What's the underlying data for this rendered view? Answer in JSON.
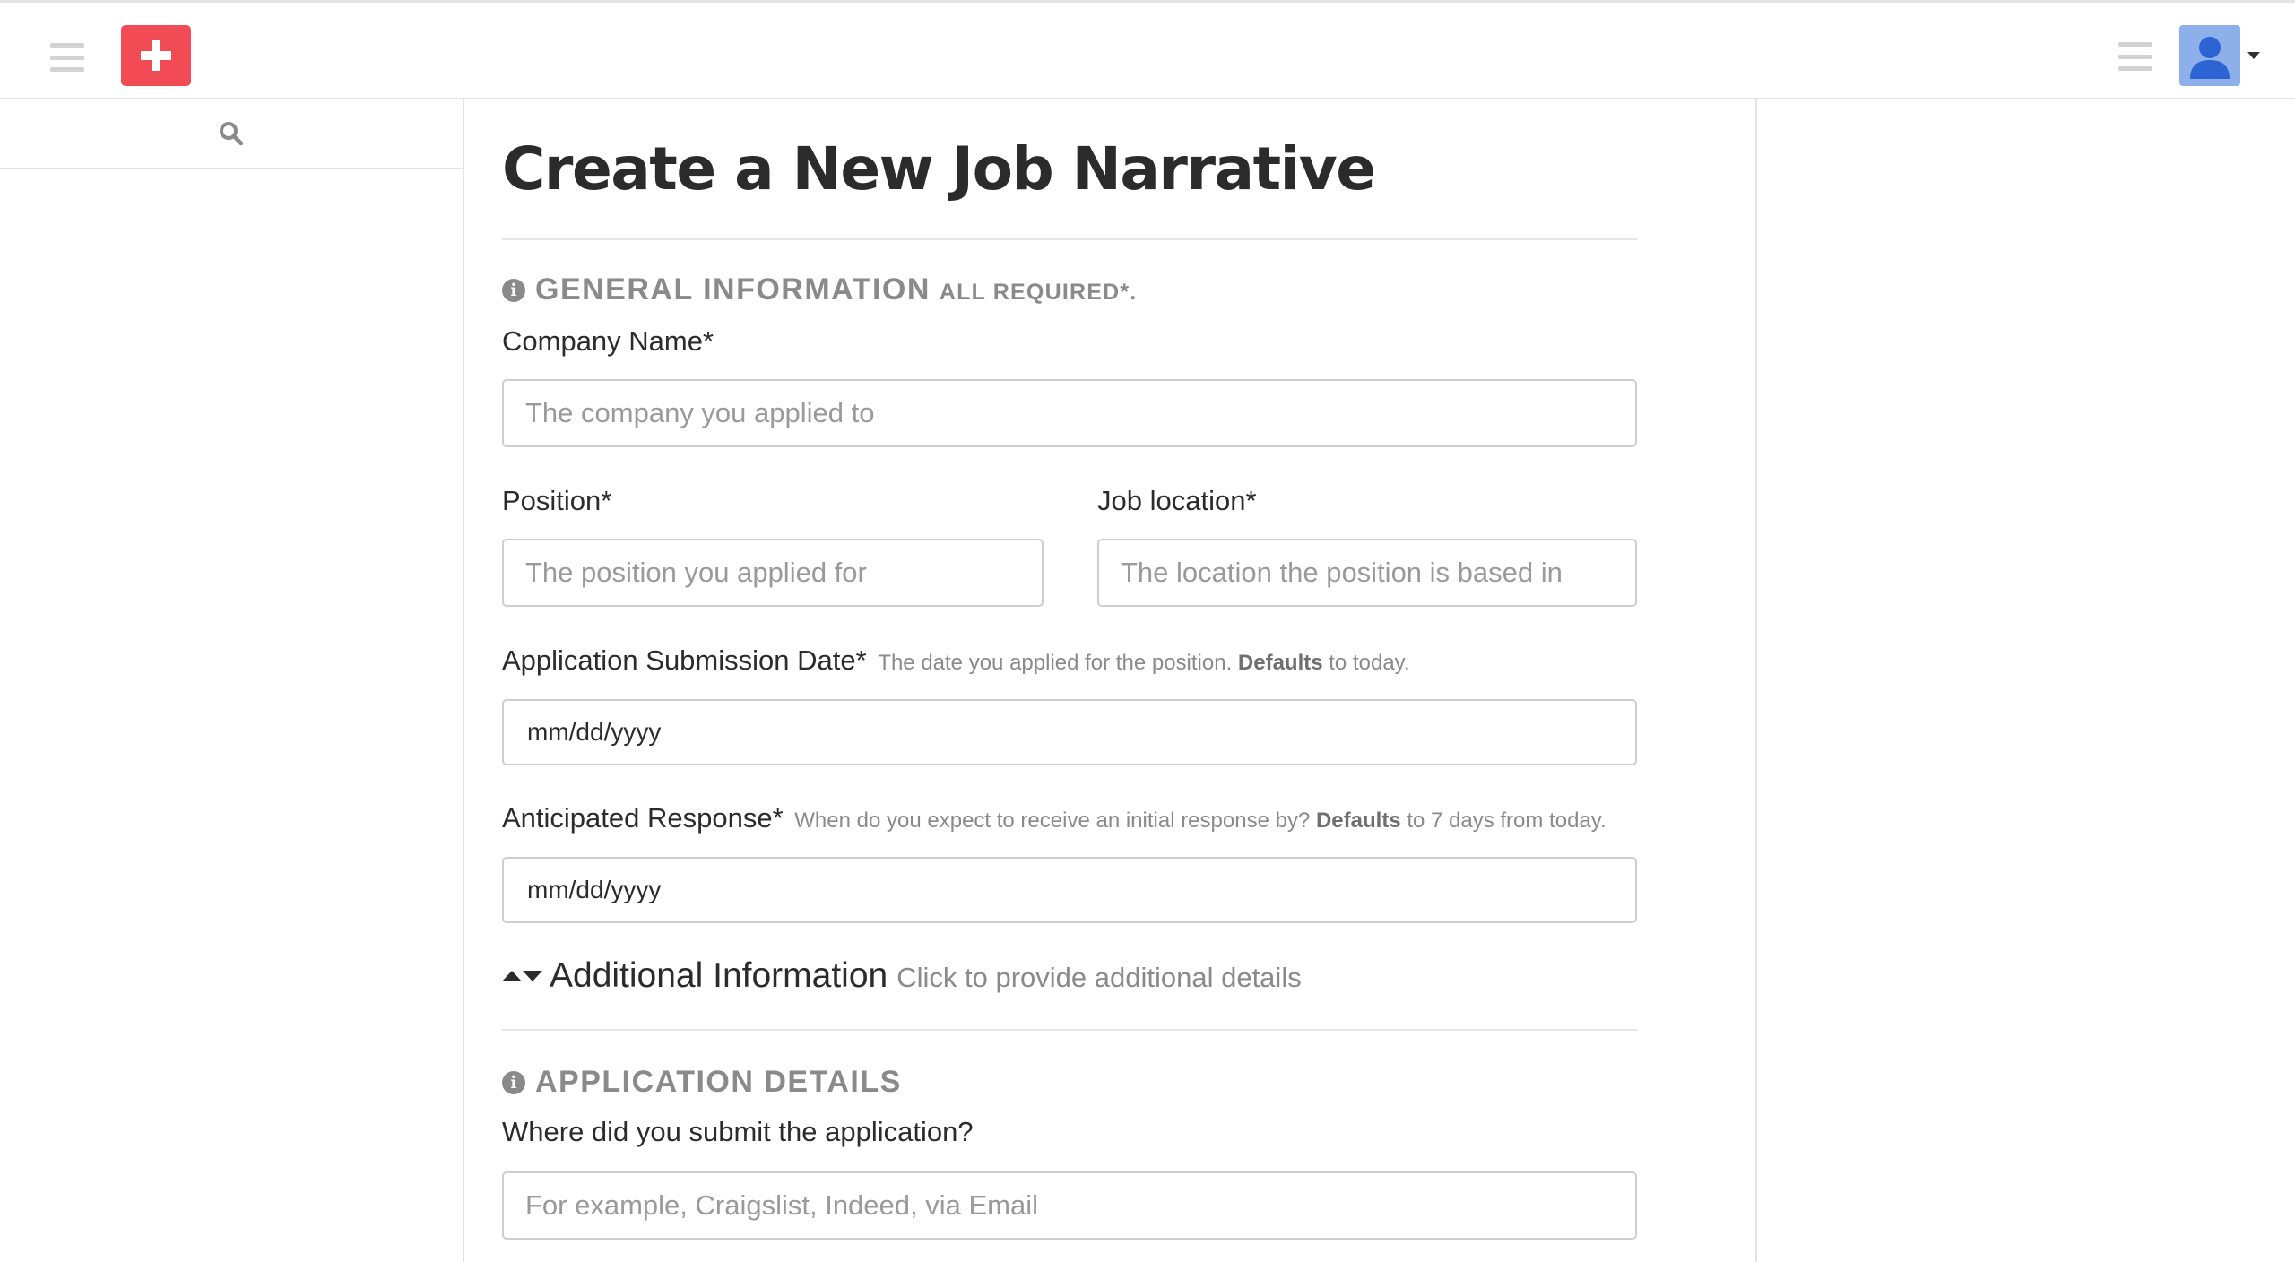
{
  "header": {
    "left_menu_icon": "hamburger-icon",
    "add_icon": "plus-icon",
    "right_menu_icon": "hamburger-icon",
    "avatar_icon": "user-icon",
    "brand_color": "#f14c55",
    "avatar_color": "#8db0ea"
  },
  "sidebar": {
    "search_icon": "search-icon"
  },
  "main": {
    "title": "Create a New Job Narrative",
    "general_section": {
      "heading": "GENERAL INFORMATION",
      "subheading": "ALL REQUIRED*."
    },
    "company": {
      "label": "Company Name*",
      "placeholder": "The company you applied to",
      "value": ""
    },
    "position": {
      "label": "Position*",
      "placeholder": "The position you applied for",
      "value": ""
    },
    "location": {
      "label": "Job location*",
      "placeholder": "The location the position is based in",
      "value": ""
    },
    "submission_date": {
      "label": "Application Submission Date*",
      "help_text": "The date you applied for the position.",
      "help_bold": "Defaults",
      "help_tail": "to today.",
      "value": "mm/dd/yyyy"
    },
    "anticipated_response": {
      "label": "Anticipated Response*",
      "help_text": "When do you expect to receive an initial response by?",
      "help_bold": "Defaults",
      "help_tail": "to 7 days from today.",
      "value": "mm/dd/yyyy"
    },
    "additional_info": {
      "title": "Additional Information",
      "hint": "Click to provide additional details"
    },
    "application_section": {
      "heading": "APPLICATION DETAILS"
    },
    "submit_where": {
      "label": "Where did you submit the application?",
      "placeholder": "For example, Craigslist, Indeed, via Email",
      "value": ""
    }
  }
}
